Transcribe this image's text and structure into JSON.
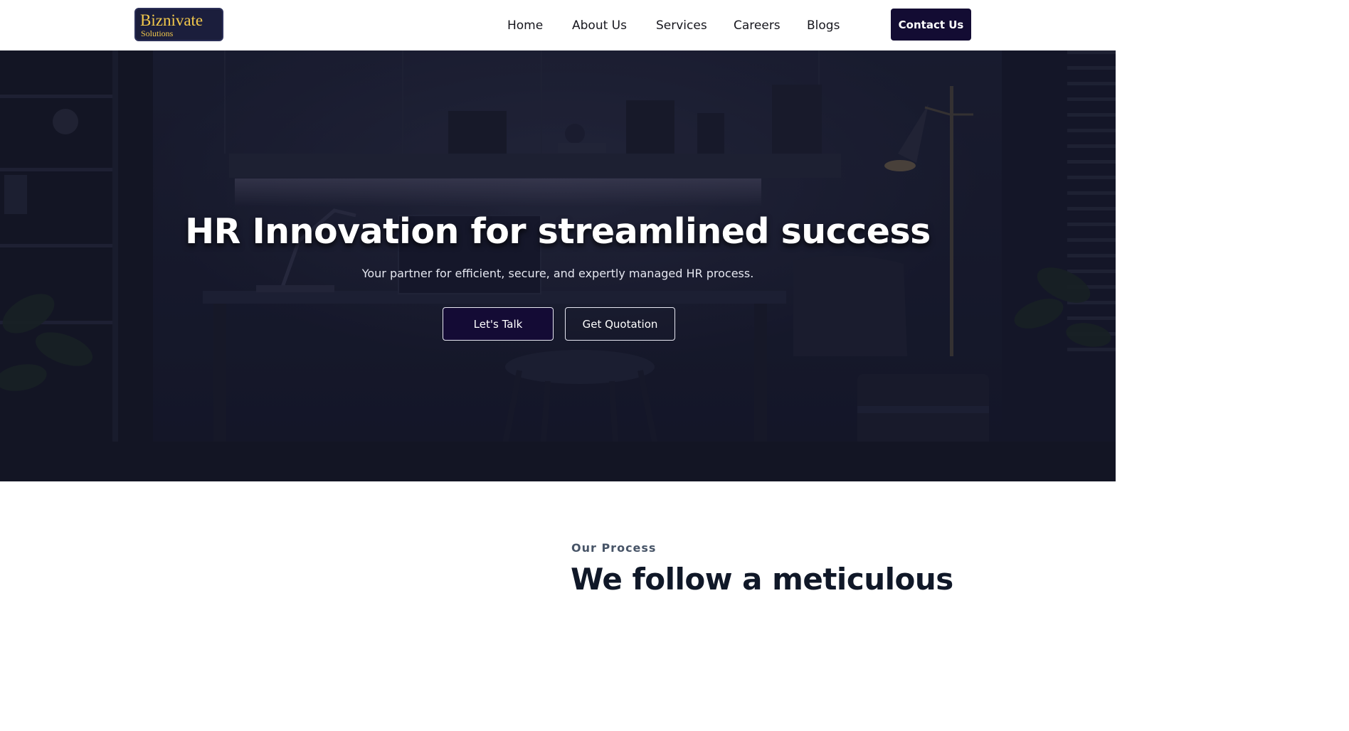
{
  "brand": {
    "name": "Biznivate",
    "subtitle": "Solutions",
    "accent_color": "#f2c84b",
    "background_color": "#1b1e3c"
  },
  "nav": {
    "items": [
      {
        "label": "Home"
      },
      {
        "label": "About Us"
      },
      {
        "label": "Services"
      },
      {
        "label": "Careers"
      },
      {
        "label": "Blogs"
      }
    ],
    "cta_label": "Contact Us",
    "cta_color": "#130c33"
  },
  "hero": {
    "title": "HR Innovation for streamlined success",
    "subtitle": "Your partner for efficient, secure, and expertly managed HR process.",
    "primary_button": "Let's Talk",
    "secondary_button": "Get Quotation",
    "background_description_icon": "dark-office-photo"
  },
  "process": {
    "eyebrow": "Our Process",
    "title": "We follow a meticulous"
  }
}
